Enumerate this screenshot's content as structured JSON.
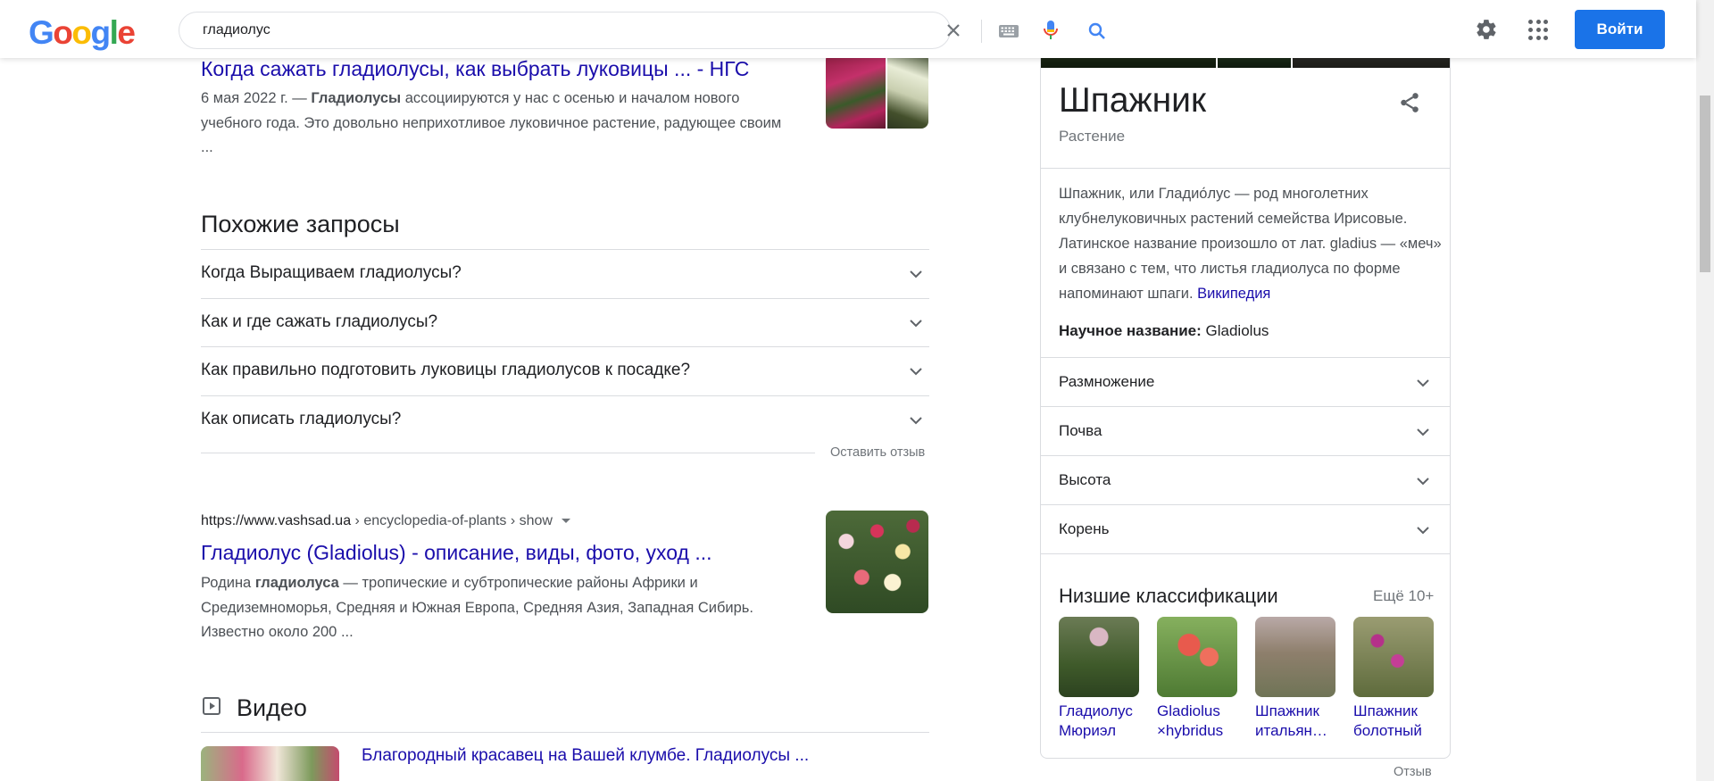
{
  "header": {
    "logo": [
      "G",
      "o",
      "o",
      "g",
      "l",
      "e"
    ],
    "logo_colors": [
      "#4285F4",
      "#EA4335",
      "#FBBC05",
      "#4285F4",
      "#34A853",
      "#EA4335"
    ],
    "query": "гладиолус",
    "signin_label": "Войти",
    "accent": "#1a73e8"
  },
  "results": [
    {
      "title": "Когда сажать гладиолусы, как выбрать луковицы ... - НГС",
      "snippet_date": "6 мая 2022 г. — ",
      "snippet_bold": "Гладиолусы",
      "snippet_rest": " ассоциируются у нас с осенью и началом нового учебного года. Это довольно неприхотливое луковичное растение, радующее своим ..."
    },
    {
      "url_host": "https://www.vashsad.ua",
      "url_path": " › encyclopedia-of-plants › show",
      "title": "Гладиолус (Gladiolus) - описание, виды, фото, уход ...",
      "snippet_pre": "Родина ",
      "snippet_bold": "гладиолуса",
      "snippet_rest": " — тропические и субтропические районы Африки и Средиземноморья, Средняя и Южная Европа, Средняя Азия, Западная Сибирь. Известно около 200 ..."
    }
  ],
  "related": {
    "heading": "Похожие запросы",
    "items": [
      "Когда Выращиваем гладиолусы?",
      "Как и где сажать гладиолусы?",
      "Как правильно подготовить луковицы гладиолусов к посадке?",
      "Как описать гладиолусы?"
    ],
    "feedback": "Оставить отзыв"
  },
  "video": {
    "heading": "Видео",
    "first_title": "Благородный красавец на Вашей клумбе. Гладиолусы ..."
  },
  "knowledge_panel": {
    "title": "Шпажник",
    "subtitle": "Растение",
    "description": "Шпажник, или Гладио́лус — род многолетних клубнелуковичных растений семейства Ирисовые. Латинское название произошло от лат. gladius — «меч» и связано с тем, что листья гладиолуса по форме напоминают шпаги. ",
    "wiki_link": "Википедия",
    "sci_label": "Научное название:",
    "sci_value": " Gladiolus",
    "attributes": [
      "Размножение",
      "Почва",
      "Высота",
      "Корень"
    ],
    "lower_title": "Низшие классификации",
    "more": "Ещё 10+",
    "cards": [
      {
        "line1": "Гладиолус",
        "line2": "Мюриэл"
      },
      {
        "line1": "Gladiolus",
        "line2": "×hybridus"
      },
      {
        "line1": "Шпажник",
        "line2": "итальян…"
      },
      {
        "line1": "Шпажник",
        "line2": "болотный"
      }
    ],
    "feedback": "Отзыв"
  }
}
